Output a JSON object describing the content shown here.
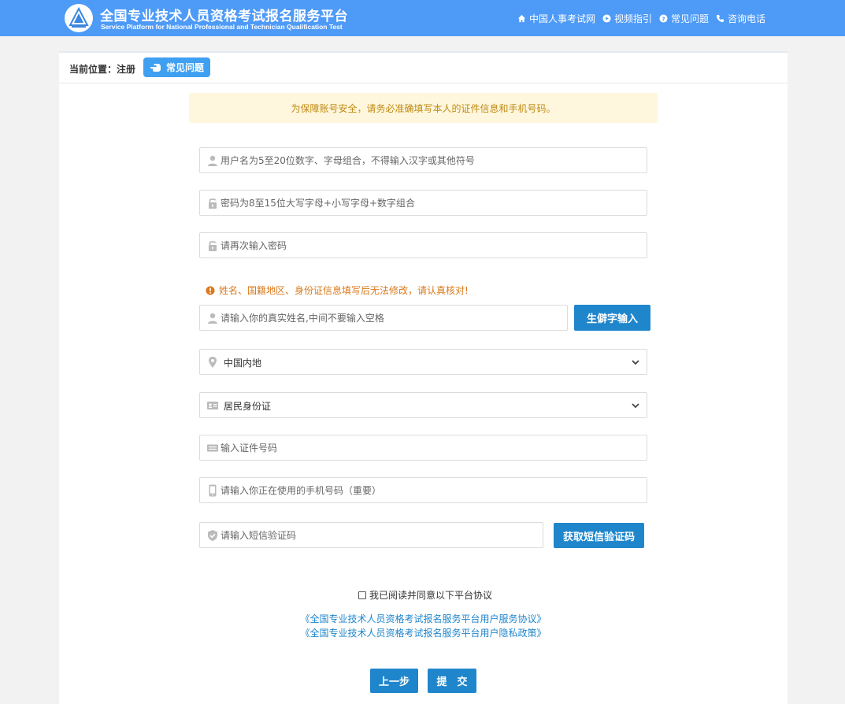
{
  "header": {
    "title_cn": "全国专业技术人员资格考试报名服务平台",
    "title_en": "Service Platform for National Professional and Technician Qualification Test",
    "nav": [
      {
        "label": "中国人事考试网",
        "icon": "home-icon"
      },
      {
        "label": "视频指引",
        "icon": "play-icon"
      },
      {
        "label": "常见问题",
        "icon": "question-icon"
      },
      {
        "label": "咨询电话",
        "icon": "phone-icon"
      }
    ]
  },
  "breadcrumb": {
    "label": "当前位置：注册",
    "faq_button": "常见问题"
  },
  "notice": "为保障账号安全，请务必准确填写本人的证件信息和手机号码。",
  "form": {
    "username": {
      "placeholder": "用户名为5至20位数字、字母组合，不得输入汉字或其他符号",
      "value": ""
    },
    "password": {
      "placeholder": "密码为8至15位大写字母+小写字母+数字组合",
      "value": ""
    },
    "password_confirm": {
      "placeholder": "请再次输入密码",
      "value": ""
    },
    "identity_warning": "姓名、国籍地区、身份证信息填写后无法修改，请认真核对!",
    "real_name": {
      "placeholder": "请输入你的真实姓名,中间不要输入空格",
      "value": ""
    },
    "rare_char_button": "生僻字输入",
    "region": {
      "selected": "中国内地"
    },
    "id_type": {
      "selected": "居民身份证"
    },
    "id_number": {
      "placeholder": "输入证件号码",
      "value": ""
    },
    "phone": {
      "placeholder": "请输入你正在使用的手机号码（重要）",
      "value": ""
    },
    "sms_code": {
      "placeholder": "请输入短信验证码",
      "value": ""
    },
    "sms_button": "获取短信验证码"
  },
  "agreement": {
    "checkbox_label": "我已阅读并同意以下平台协议",
    "checked": false,
    "links": [
      "《全国专业技术人员资格考试报名服务平台用户服务协议》",
      "《全国专业技术人员资格考试报名服务平台用户隐私政策》"
    ]
  },
  "buttons": {
    "prev": "上一步",
    "submit": "提　交"
  },
  "colors": {
    "header_bg": "#4e9af7",
    "button_blue": "#1f86cc",
    "notice_bg": "#fef7dd",
    "notice_text": "#c08a13",
    "warning": "#d9791c"
  }
}
